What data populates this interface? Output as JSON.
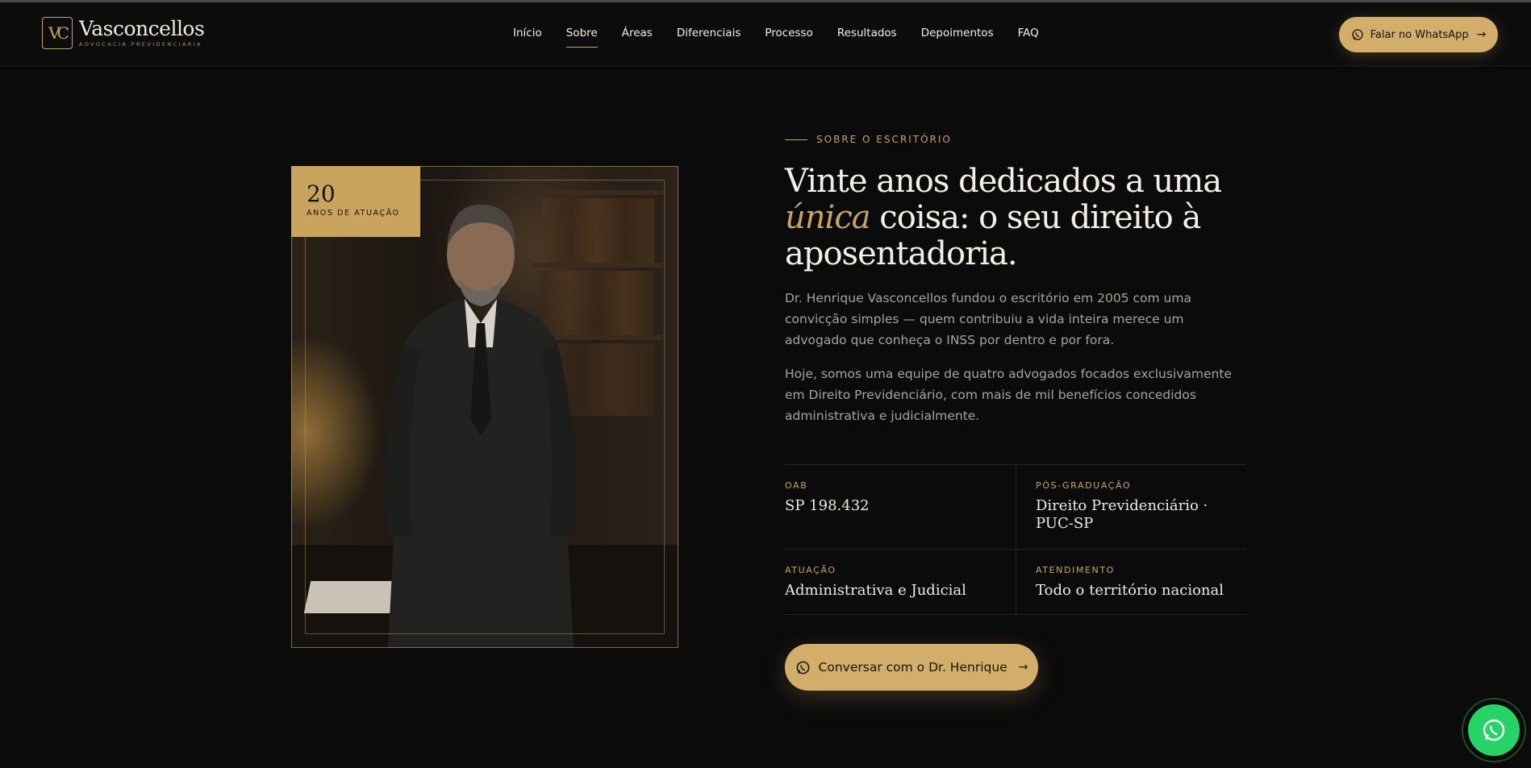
{
  "brand": {
    "monogram": "VC",
    "name": "Vasconcellos",
    "tagline": "ADVOCACIA PREVIDENCIÁRIA"
  },
  "nav": {
    "items": [
      "Início",
      "Sobre",
      "Áreas",
      "Diferenciais",
      "Processo",
      "Resultados",
      "Depoimentos",
      "FAQ"
    ],
    "active": "Sobre"
  },
  "header": {
    "whatsapp_label": "Falar no WhatsApp"
  },
  "about": {
    "eyebrow": "SOBRE O ESCRITÓRIO",
    "title_part1": "Vinte anos dedicados a uma ",
    "title_em": "única",
    "title_part2": " coisa: o seu direito à aposentadoria.",
    "paragraph1": "Dr. Henrique Vasconcellos fundou o escritório em 2005 com uma convicção simples — quem contribuiu a vida inteira merece um advogado que conheça o INSS por dentro e por fora.",
    "paragraph2": "Hoje, somos uma equipe de quatro advogados focados exclusivamente em Direito Previdenciário, com mais de mil benefícios concedidos administrativa e judicialmente.",
    "badge_number": "20",
    "badge_label": "ANOS DE ATUAÇÃO",
    "facts": [
      {
        "label": "OAB",
        "value": "SP 198.432"
      },
      {
        "label": "PÓS-GRADUAÇÃO",
        "value": "Direito Previdenciário · PUC-SP"
      },
      {
        "label": "ATUAÇÃO",
        "value": "Administrativa e Judicial"
      },
      {
        "label": "ATENDIMENTO",
        "value": "Todo o território nacional"
      }
    ],
    "cta_label": "Conversar com o Dr. Henrique"
  },
  "colors": {
    "accent": "#c9a45f",
    "background": "#0b0b0b",
    "whatsapp": "#25d366"
  },
  "icons": {
    "whatsapp": "whatsapp-icon",
    "arrow": "arrow-right-icon"
  }
}
